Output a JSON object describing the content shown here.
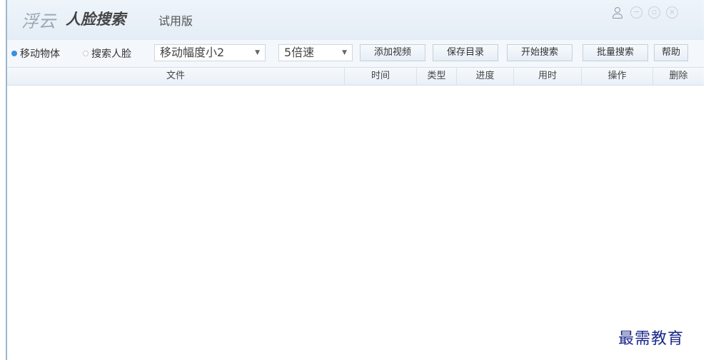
{
  "titlebar": {
    "brand": "浮云",
    "product": "人脸搜索",
    "edition": "试用版",
    "icons": {
      "user": "user-icon",
      "minimize": "minimize-icon",
      "maximize": "maximize-icon",
      "close": "close-icon"
    }
  },
  "toolbar": {
    "modes": [
      {
        "label": "移动物体",
        "selected": true
      },
      {
        "label": "搜索人脸",
        "selected": false
      }
    ],
    "motion_select": {
      "value": "移动幅度小2"
    },
    "speed_select": {
      "value": "5倍速"
    },
    "buttons": {
      "add_video": "添加视频",
      "save_dir": "保存目录",
      "start_search": "开始搜索",
      "batch_search": "批量搜索",
      "help": "帮助"
    }
  },
  "table": {
    "columns": [
      "文件",
      "时间",
      "类型",
      "进度",
      "用时",
      "操作",
      "删除"
    ],
    "rows": []
  },
  "watermark": "最需教育",
  "colors": {
    "accent": "#3b8fe0",
    "titlebar_bg": "#e8f0f8",
    "watermark": "#1c2a8a"
  }
}
